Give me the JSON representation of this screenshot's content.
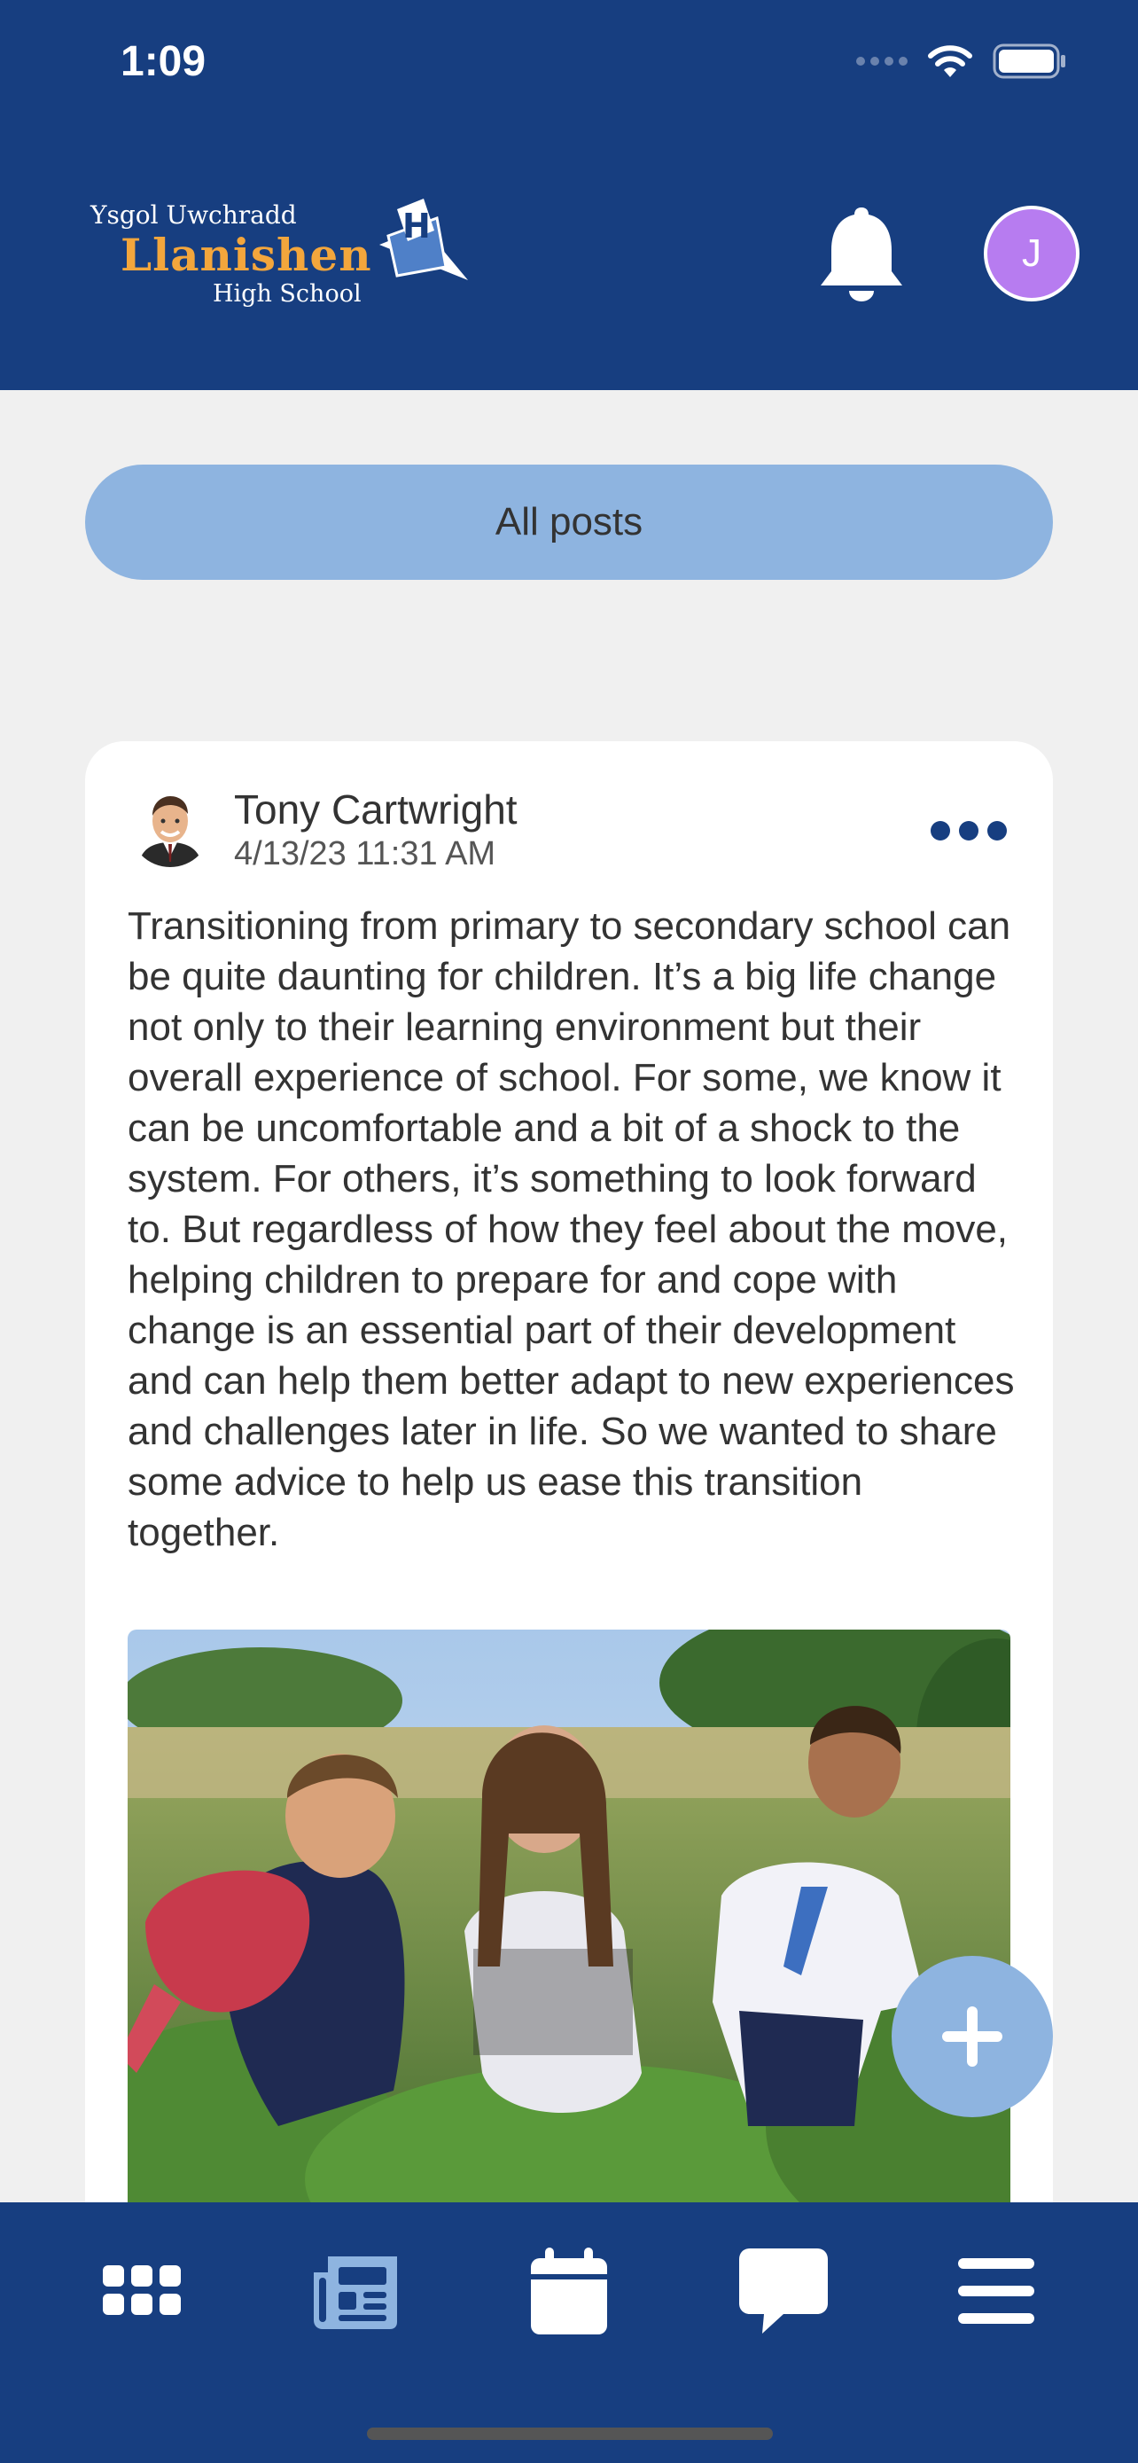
{
  "status": {
    "time": "1:09"
  },
  "school": {
    "line1": "Ysgol Uwchradd",
    "line2": "Llanishen",
    "line3": "High School"
  },
  "user": {
    "initial": "J"
  },
  "filter": {
    "label": "All posts"
  },
  "post": {
    "author": "Tony Cartwright",
    "date": "4/13/23 11:31 AM",
    "body": "Transitioning from primary to secondary school can be quite daunting for children. It’s a big life change not only to their learning environment but their overall experience of school. For some, we know it can be uncomfortable and a bit of a shock to the system. For others, it’s something to look forward to. But regardless of how they feel about the move, helping children to prepare for and cope with change is an essential part of their development and can help them better adapt to new experiences and challenges later in life. So we wanted to share some advice to help us ease this transition together."
  },
  "tabs": [
    {
      "icon": "apps-grid-icon"
    },
    {
      "icon": "newspaper-icon"
    },
    {
      "icon": "calendar-icon"
    },
    {
      "icon": "chat-icon"
    },
    {
      "icon": "menu-icon"
    }
  ],
  "colors": {
    "primary": "#173e80",
    "accent": "#8eb4e0",
    "logo_orange": "#f3a63c",
    "avatar": "#b77cf0"
  }
}
